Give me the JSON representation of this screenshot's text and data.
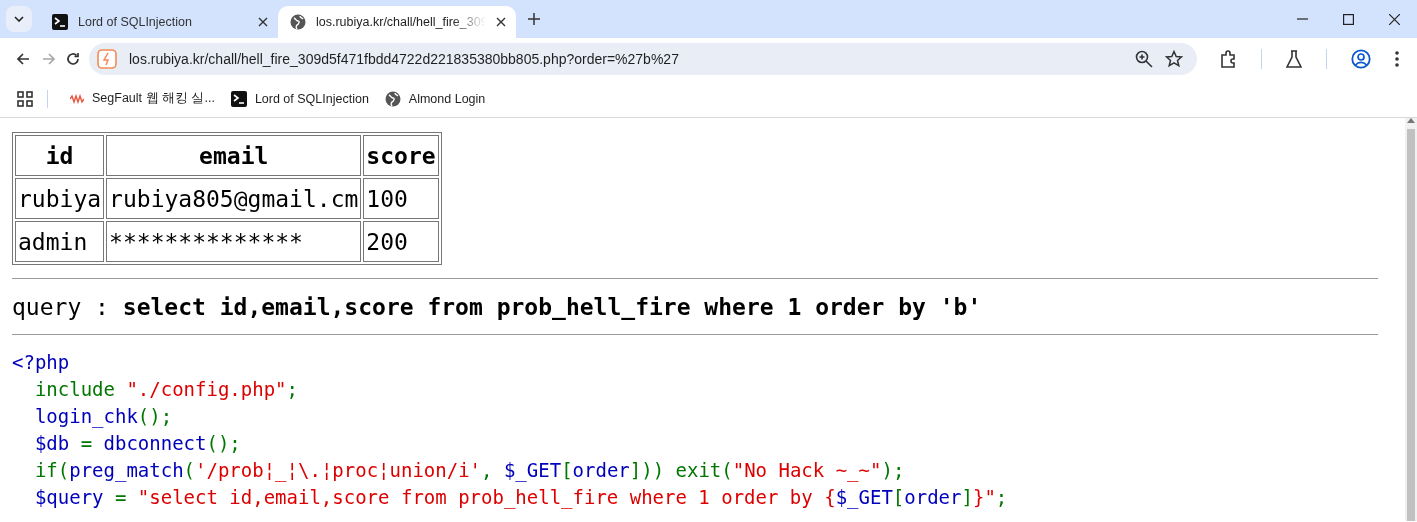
{
  "tabs": [
    {
      "title": "Lord of SQLInjection",
      "selected": false
    },
    {
      "title": "los.rubiya.kr/chall/hell_fire_309",
      "selected": true
    }
  ],
  "toolbar": {
    "nav_buttons": [
      {
        "disabled": false
      },
      {
        "disabled": true
      },
      {
        "disabled": false
      }
    ],
    "url": "los.rubiya.kr/chall/hell_fire_309d5f471fbdd4722d221835380bb805.php?order=%27b%27"
  },
  "bookmarks": [
    {
      "title": "SegFault 웹 해킹 실..."
    },
    {
      "title": "Lord of SQLInjection"
    },
    {
      "title": "Almond Login"
    }
  ],
  "table": {
    "columns": [
      "id",
      "email",
      "score"
    ],
    "rows": [
      [
        "rubiya",
        "rubiya805@gmail.cm",
        "100"
      ],
      [
        "admin",
        "**************",
        "200"
      ]
    ]
  },
  "query": "query : **select id,email,score from prob_hell_fire where 1 order by 'b'**",
  "code_lines": [
    [
      {
        "text": "<?php",
        "color": "#0000bb"
      }
    ],
    [
      {
        "text": "  include ",
        "color": "#007700"
      },
      {
        "text": "\"./config.php\"",
        "color": "#dd0000"
      },
      {
        "text": ";",
        "color": "#007700"
      }
    ],
    [
      {
        "text": "  login_chk",
        "color": "#0000bb"
      },
      {
        "text": "();",
        "color": "#007700"
      }
    ],
    [
      {
        "text": "  $db ",
        "color": "#0000bb"
      },
      {
        "text": "= ",
        "color": "#007700"
      },
      {
        "text": "dbconnect",
        "color": "#0000bb"
      },
      {
        "text": "();",
        "color": "#007700"
      }
    ],
    [
      {
        "text": "  if(",
        "color": "#007700"
      },
      {
        "text": "preg_match",
        "color": "#0000bb"
      },
      {
        "text": "(",
        "color": "#007700"
      },
      {
        "text": "'/prob¦_¦\\.¦proc¦union/i'",
        "color": "#dd0000"
      },
      {
        "text": ", ",
        "color": "#007700"
      },
      {
        "text": "$_GET",
        "color": "#0000bb"
      },
      {
        "text": "[",
        "color": "#007700"
      },
      {
        "text": "order",
        "color": "#0000bb"
      },
      {
        "text": "])) exit(",
        "color": "#007700"
      },
      {
        "text": "\"No Hack ~_~\"",
        "color": "#dd0000"
      },
      {
        "text": ");",
        "color": "#007700"
      }
    ],
    [
      {
        "text": "  $query ",
        "color": "#0000bb"
      },
      {
        "text": "= ",
        "color": "#007700"
      },
      {
        "text": "\"select id,email,score from prob_hell_fire where 1 order by {",
        "color": "#dd0000"
      },
      {
        "text": "$_GET",
        "color": "#0000bb"
      },
      {
        "text": "[",
        "color": "#007700"
      },
      {
        "text": "order",
        "color": "#0000bb"
      },
      {
        "text": "]",
        "color": "#007700"
      },
      {
        "text": "}\"",
        "color": "#dd0000"
      },
      {
        "text": ";",
        "color": "#007700"
      }
    ]
  ]
}
